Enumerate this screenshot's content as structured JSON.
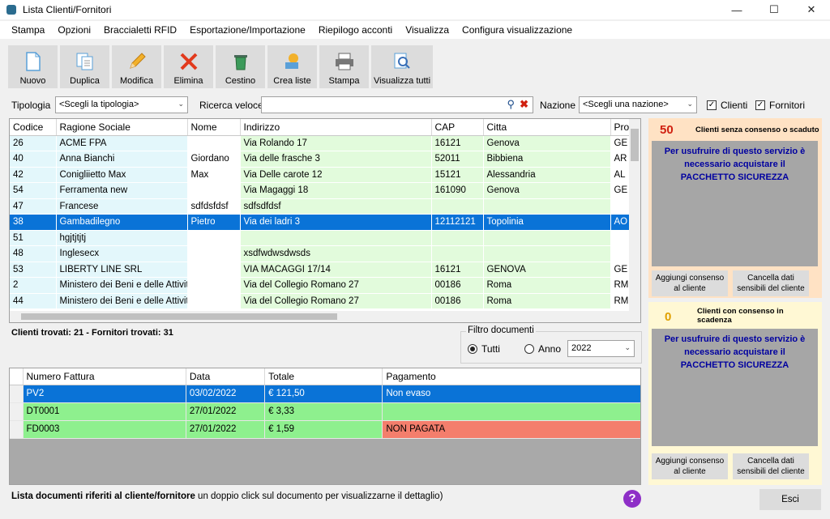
{
  "window": {
    "title": "Lista Clienti/Fornitori"
  },
  "menu": [
    "Stampa",
    "Opzioni",
    "Braccialetti RFID",
    "Esportazione/Importazione",
    "Riepilogo acconti",
    "Visualizza",
    "Configura visualizzazione"
  ],
  "toolbar": [
    {
      "label": "Nuovo",
      "icon": "new-document-icon"
    },
    {
      "label": "Duplica",
      "icon": "duplicate-icon"
    },
    {
      "label": "Modifica",
      "icon": "pencil-icon"
    },
    {
      "label": "Elimina",
      "icon": "delete-x-icon"
    },
    {
      "label": "Cestino",
      "icon": "trash-bin-icon"
    },
    {
      "label": "Crea liste",
      "icon": "create-list-icon"
    },
    {
      "label": "Stampa",
      "icon": "printer-icon"
    },
    {
      "label": "Visualizza tutti",
      "icon": "view-all-icon"
    }
  ],
  "filters": {
    "tipologia_label": "Tipologia",
    "tipologia_value": "<Scegli la tipologia>",
    "ricerca_label": "Ricerca veloce",
    "ricerca_value": "",
    "nazione_label": "Nazione",
    "nazione_value": "<Scegli una nazione>",
    "clienti_label": "Clienti",
    "clienti_checked": true,
    "fornitori_label": "Fornitori",
    "fornitori_checked": true
  },
  "clients_table": {
    "columns": [
      "Codice",
      "Ragione Sociale",
      "Nome",
      "Indirizzo",
      "CAP",
      "Citta",
      "Prov"
    ],
    "rows": [
      [
        "26",
        "ACME FPA",
        "",
        "Via Rolando 17",
        "16121",
        "Genova",
        "GE"
      ],
      [
        "40",
        "Anna Bianchi",
        "Giordano",
        "Via delle frasche 3",
        "52011",
        "Bibbiena",
        "AR"
      ],
      [
        "42",
        "Conigliietto Max",
        "Max",
        "Via Delle carote 12",
        "15121",
        "Alessandria",
        "AL"
      ],
      [
        "54",
        "Ferramenta new",
        "",
        "Via Magaggi 18",
        "161090",
        "Genova",
        "GE"
      ],
      [
        "47",
        "Francese",
        "sdfdsfdsf",
        "sdfsdfdsf",
        "",
        "",
        ""
      ],
      [
        "38",
        "Gambadilegno",
        "Pietro",
        "Via dei ladri 3",
        "12112121",
        "Topolinia",
        "AO"
      ],
      [
        "51",
        "hgjtjtjtj",
        "",
        "",
        "",
        "",
        ""
      ],
      [
        "48",
        "Inglesecx",
        "",
        "xsdfwdwsdwsds",
        "",
        "",
        ""
      ],
      [
        "53",
        "LIBERTY LINE SRL",
        "",
        "VIA MACAGGI 17/14",
        "16121",
        "GENOVA",
        "GE"
      ],
      [
        "2",
        "Ministero dei Beni e delle Attivit",
        "",
        "Via del Collegio Romano 27",
        "00186",
        "Roma",
        "RM"
      ],
      [
        "44",
        "Ministero dei Beni e delle Attivit",
        "",
        "Via del Collegio Romano 27",
        "00186",
        "Roma",
        "RM"
      ]
    ],
    "selected_index": 5
  },
  "counts_text": "Clienti trovati: 21 - Fornitori trovati: 31",
  "doc_filter": {
    "legend": "Filtro documenti",
    "tutti_label": "Tutti",
    "anno_label": "Anno",
    "selected": "Tutti",
    "year_value": "2022"
  },
  "docs_table": {
    "columns": [
      "Numero Fattura",
      "Data",
      "Totale",
      "Pagamento"
    ],
    "rows": [
      [
        "PV2",
        "03/02/2022",
        "€ 121,50",
        "Non evaso"
      ],
      [
        "DT0001",
        "27/01/2022",
        "€ 3,33",
        ""
      ],
      [
        "FD0003",
        "27/01/2022",
        "€ 1,59",
        "NON PAGATA"
      ]
    ]
  },
  "bottom": {
    "bold_text": "Lista documenti riferiti al cliente/fornitore",
    "hint_text": " un doppio click sul documento per visualizzarne il dettaglio)",
    "help": "?",
    "exit_button": "Esci"
  },
  "panel_no_consent": {
    "count": "50",
    "title": "Clienti senza consenso o scaduto",
    "message": "Per usufruire di questo servizio è necessario acquistare il PACCHETTO SICUREZZA",
    "btn_add": "Aggiungi consenso al cliente",
    "btn_delete": "Cancella dati sensibili del cliente"
  },
  "panel_expiring": {
    "count": "0",
    "title": "Clienti con consenso in scadenza",
    "message": "Per usufruire di questo servizio è necessario acquistare il PACCHETTO SICUREZZA",
    "btn_add": "Aggiungi consenso al cliente",
    "btn_delete": "Cancella dati sensibili del cliente"
  },
  "colors": {
    "selection": "#0a73d7",
    "row_blue": "#e3f7fb",
    "row_green": "#e2fbdc",
    "doc_green": "#8ef08e",
    "doc_red": "#f47e6c",
    "panel1_bg": "#ffe2c4",
    "panel2_bg": "#fff8d4"
  }
}
